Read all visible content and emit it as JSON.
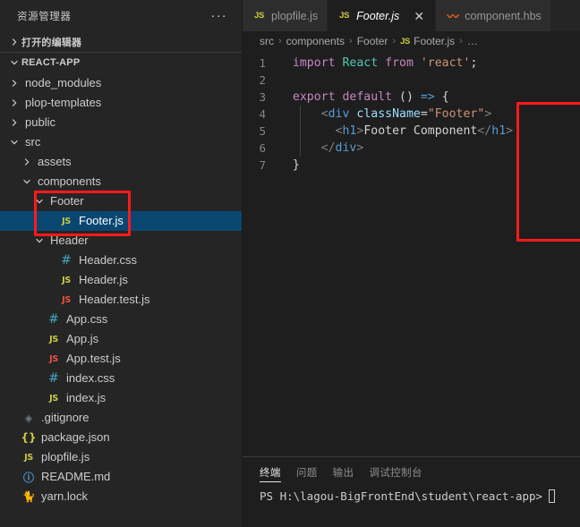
{
  "sidebar": {
    "title": "资源管理器",
    "more_actions": "···",
    "open_editors_label": "打开的编辑器",
    "project_label": "REACT-APP",
    "tree": [
      {
        "label": "node_modules",
        "type": "folder",
        "expanded": false,
        "depth": 1
      },
      {
        "label": "plop-templates",
        "type": "folder",
        "expanded": false,
        "depth": 1
      },
      {
        "label": "public",
        "type": "folder",
        "expanded": false,
        "depth": 1
      },
      {
        "label": "src",
        "type": "folder",
        "expanded": true,
        "depth": 1
      },
      {
        "label": "assets",
        "type": "folder",
        "expanded": false,
        "depth": 2
      },
      {
        "label": "components",
        "type": "folder",
        "expanded": true,
        "depth": 2
      },
      {
        "label": "Footer",
        "type": "folder",
        "expanded": true,
        "depth": 3
      },
      {
        "label": "Footer.js",
        "type": "js",
        "icon": "JS",
        "depth": 4,
        "selected": true
      },
      {
        "label": "Header",
        "type": "folder",
        "expanded": true,
        "depth": 3
      },
      {
        "label": "Header.css",
        "type": "css",
        "icon": "#",
        "depth": 4
      },
      {
        "label": "Header.js",
        "type": "js",
        "icon": "JS",
        "depth": 4
      },
      {
        "label": "Header.test.js",
        "type": "test",
        "icon": "JS",
        "depth": 4
      },
      {
        "label": "App.css",
        "type": "css",
        "icon": "#",
        "depth": 3
      },
      {
        "label": "App.js",
        "type": "js",
        "icon": "JS",
        "depth": 3
      },
      {
        "label": "App.test.js",
        "type": "test",
        "icon": "JS",
        "depth": 3
      },
      {
        "label": "index.css",
        "type": "css",
        "icon": "#",
        "depth": 3
      },
      {
        "label": "index.js",
        "type": "js",
        "icon": "JS",
        "depth": 3
      },
      {
        "label": ".gitignore",
        "type": "git",
        "icon": "◈",
        "depth": 1
      },
      {
        "label": "package.json",
        "type": "json",
        "icon": "{}",
        "depth": 1
      },
      {
        "label": "plopfile.js",
        "type": "js",
        "icon": "JS",
        "depth": 1
      },
      {
        "label": "README.md",
        "type": "md",
        "icon": "ⓘ",
        "depth": 1
      },
      {
        "label": "yarn.lock",
        "type": "yarn",
        "icon": "🐈",
        "depth": 1
      }
    ]
  },
  "tabs": [
    {
      "label": "plopfile.js",
      "icon": "JS",
      "icon_kind": "js",
      "active": false,
      "preview": false,
      "closable": false
    },
    {
      "label": "Footer.js",
      "icon": "JS",
      "icon_kind": "js",
      "active": true,
      "preview": true,
      "closable": true,
      "close_glyph": "✕"
    },
    {
      "label": "component.hbs",
      "icon": "〰",
      "icon_kind": "hbs",
      "active": false,
      "preview": false,
      "closable": false
    }
  ],
  "breadcrumb": {
    "separator": "›",
    "items": [
      "src",
      "components",
      "Footer",
      "Footer.js",
      "…"
    ],
    "file_icon": "JS"
  },
  "code": {
    "lines": [
      {
        "num": "1",
        "tokens": [
          {
            "t": "  ",
            "c": "plain"
          },
          {
            "t": "import",
            "c": "kw"
          },
          {
            "t": " ",
            "c": "plain"
          },
          {
            "t": "React",
            "c": "cls"
          },
          {
            "t": " ",
            "c": "plain"
          },
          {
            "t": "from",
            "c": "kw"
          },
          {
            "t": " ",
            "c": "plain"
          },
          {
            "t": "'react'",
            "c": "str"
          },
          {
            "t": ";",
            "c": "plain"
          }
        ]
      },
      {
        "num": "2",
        "tokens": []
      },
      {
        "num": "3",
        "tokens": [
          {
            "t": "  ",
            "c": "plain"
          },
          {
            "t": "export",
            "c": "kw"
          },
          {
            "t": " ",
            "c": "plain"
          },
          {
            "t": "default",
            "c": "kw"
          },
          {
            "t": " ",
            "c": "plain"
          },
          {
            "t": "()",
            "c": "plain"
          },
          {
            "t": " ",
            "c": "plain"
          },
          {
            "t": "=>",
            "c": "arrow"
          },
          {
            "t": " ",
            "c": "plain"
          },
          {
            "t": "{",
            "c": "plain"
          }
        ]
      },
      {
        "num": "4",
        "guide": true,
        "tokens": [
          {
            "t": "      ",
            "c": "plain"
          },
          {
            "t": "<",
            "c": "punc"
          },
          {
            "t": "div",
            "c": "tag"
          },
          {
            "t": " ",
            "c": "plain"
          },
          {
            "t": "className",
            "c": "attr"
          },
          {
            "t": "=",
            "c": "plain"
          },
          {
            "t": "\"Footer\"",
            "c": "str"
          },
          {
            "t": ">",
            "c": "punc"
          }
        ]
      },
      {
        "num": "5",
        "guide": true,
        "tokens": [
          {
            "t": "        ",
            "c": "plain"
          },
          {
            "t": "<",
            "c": "punc"
          },
          {
            "t": "h1",
            "c": "tag"
          },
          {
            "t": ">",
            "c": "punc"
          },
          {
            "t": "Footer Component",
            "c": "plain"
          },
          {
            "t": "</",
            "c": "punc"
          },
          {
            "t": "h1",
            "c": "tag"
          },
          {
            "t": ">",
            "c": "punc"
          }
        ]
      },
      {
        "num": "6",
        "guide": true,
        "tokens": [
          {
            "t": "      ",
            "c": "plain"
          },
          {
            "t": "</",
            "c": "punc"
          },
          {
            "t": "div",
            "c": "tag"
          },
          {
            "t": ">",
            "c": "punc"
          }
        ]
      },
      {
        "num": "7",
        "tokens": [
          {
            "t": "  ",
            "c": "plain"
          },
          {
            "t": "}",
            "c": "plain"
          }
        ]
      }
    ]
  },
  "panel": {
    "tabs": [
      {
        "label": "终端",
        "active": true
      },
      {
        "label": "问题",
        "active": false
      },
      {
        "label": "输出",
        "active": false
      },
      {
        "label": "调试控制台",
        "active": false
      }
    ],
    "terminal_prompt": "PS H:\\lagou-BigFrontEnd\\student\\react-app>"
  },
  "annotations": {
    "highlight_color": "#ff1a1a",
    "boxes": [
      {
        "name": "footer-folder-highlight"
      },
      {
        "name": "footer-code-highlight"
      }
    ]
  }
}
